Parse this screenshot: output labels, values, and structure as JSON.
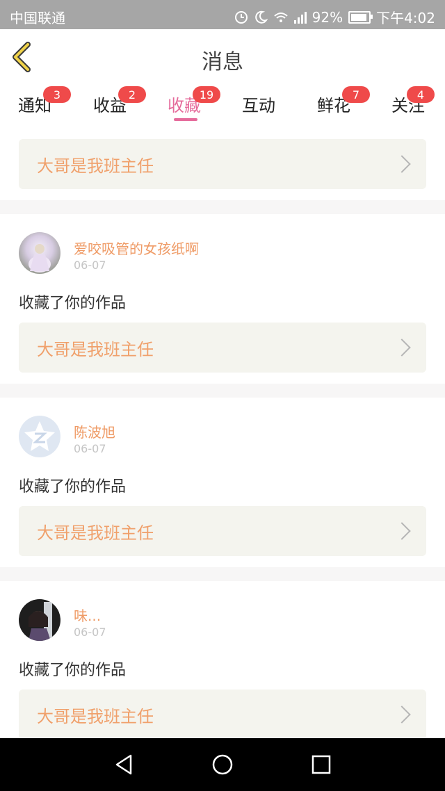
{
  "status_bar": {
    "carrier": "中国联通",
    "battery": "92%",
    "time": "下午4:02"
  },
  "header": {
    "title": "消息",
    "back_icon": "chevron-left-icon"
  },
  "tabs": [
    {
      "label": "通知",
      "badge": "3"
    },
    {
      "label": "收益",
      "badge": "2"
    },
    {
      "label": "收藏",
      "badge": "19"
    },
    {
      "label": "互动",
      "badge": ""
    },
    {
      "label": "鲜花",
      "badge": "7"
    },
    {
      "label": "关注",
      "badge": "4"
    }
  ],
  "top_link": {
    "title": "大哥是我班主任"
  },
  "items": [
    {
      "name": "爱咬吸管的女孩纸啊",
      "date": "06-07",
      "action": "收藏了你的作品",
      "work": "大哥是我班主任"
    },
    {
      "name": "陈波旭",
      "date": "06-07",
      "action": "收藏了你的作品",
      "work": "大哥是我班主任"
    },
    {
      "name": "味...",
      "date": "06-07",
      "action": "收藏了你的作品",
      "work": "大哥是我班主任"
    }
  ],
  "colors": {
    "accent_pink": "#e56b9b",
    "badge_red": "#ef4a4a",
    "name_orange": "#ef9b66",
    "work_orange": "#f0a06b"
  }
}
